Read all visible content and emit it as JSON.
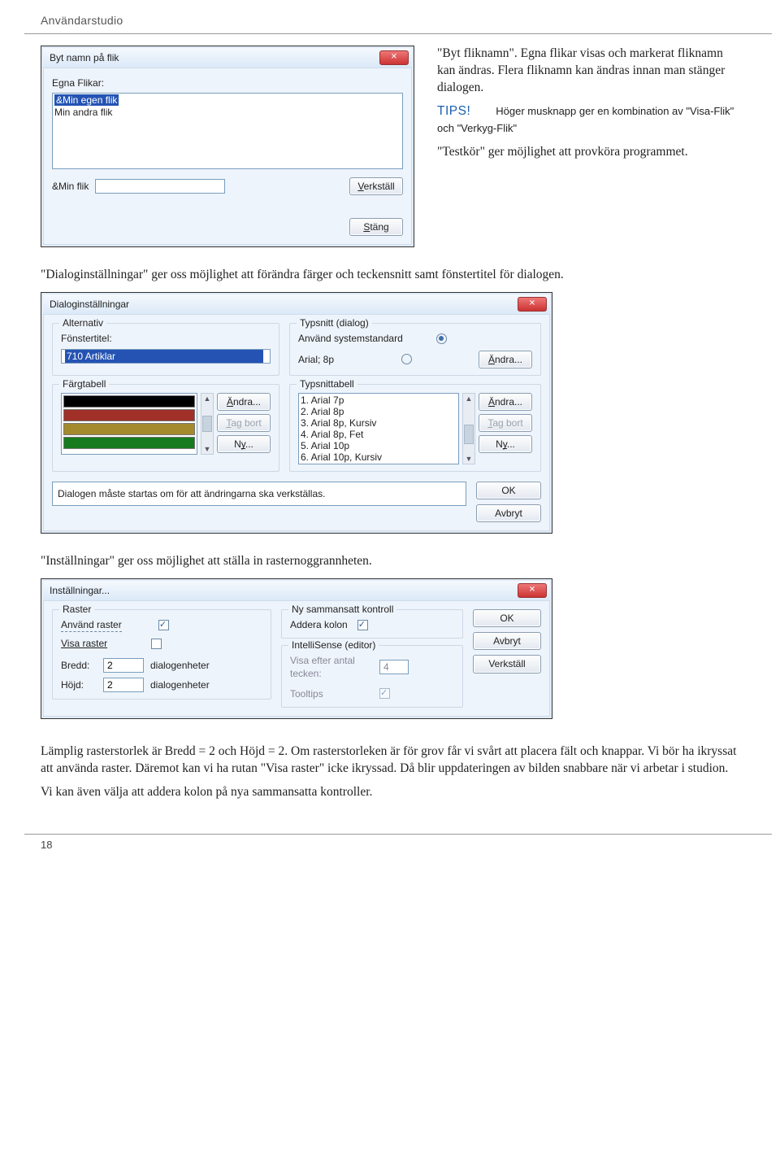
{
  "header": {
    "studio": "Användarstudio"
  },
  "dlg1": {
    "title": "Byt namn på flik",
    "label_egna": "Egna Flikar:",
    "items": [
      "&Min egen flik",
      "Min andra flik"
    ],
    "label_minflik": "&Min flik",
    "btn_verk": "Verkställ",
    "btn_stang": "Stäng"
  },
  "article": {
    "p1": "\"Byt fliknamn\". Egna flikar visas och markerat fliknamn kan ändras. Flera fliknamn kan ändras innan man stänger dialogen.",
    "tips_label": "TIPS!",
    "tips_text": "Höger musknapp ger en kombination av \"Visa-Flik\" och \"Verkyg-Flik\"",
    "p2": "\"Testkör\" ger möjlighet att provköra programmet."
  },
  "inter1": "\"Dialoginställningar\" ger oss möjlighet att förändra färger och teckensnitt samt fönstertitel för dialogen.",
  "dlg2": {
    "title": "Dialoginställningar",
    "grp_alt": "Alternativ",
    "lbl_font": "Fönstertitel:",
    "val_font": "710 Artiklar",
    "grp_typ": "Typsnitt (dialog)",
    "lbl_sys": "Använd systemstandard",
    "lbl_arial": "Arial; 8p",
    "btn_andra": "Ändra...",
    "grp_farg": "Färgtabell",
    "grp_typtab": "Typsnittabell",
    "typitems": [
      "1. Arial 7p",
      "2. Arial 8p",
      "3. Arial 8p, Kursiv",
      "4. Arial 8p, Fet",
      "5. Arial 10p",
      "6. Arial 10p, Kursiv"
    ],
    "btn_tagbort": "Tag bort",
    "btn_ny": "Ny...",
    "note": "Dialogen måste startas om för att ändringarna ska verkställas.",
    "btn_ok": "OK",
    "btn_avbryt": "Avbryt"
  },
  "inter2": "\"Inställningar\" ger oss möjlighet att ställa in rasternoggrannheten.",
  "dlg3": {
    "title": "Inställningar...",
    "grp_raster": "Raster",
    "lbl_anv": "Använd raster",
    "lbl_visa": "Visa raster",
    "lbl_bredd": "Bredd:",
    "lbl_hojd": "Höjd:",
    "val_bredd": "2",
    "val_hojd": "2",
    "unit": "dialogenheter",
    "grp_ny": "Ny sammansatt kontroll",
    "lbl_addera": "Addera kolon",
    "grp_is": "IntelliSense (editor)",
    "lbl_visa_antal": "Visa efter antal tecken:",
    "val_antal": "4",
    "lbl_tooltips": "Tooltips",
    "btn_ok": "OK",
    "btn_avbryt": "Avbryt",
    "btn_verk": "Verkställ"
  },
  "bottom": {
    "p1": "Lämplig rasterstorlek är Bredd = 2 och Höjd = 2. Om rasterstorleken är för grov får vi svårt att placera fält och knappar.  Vi bör ha ikryssat att använda raster. Däremot kan vi ha rutan \"Visa raster\" icke ikryssad. Då blir uppdateringen av bilden snabbare när vi arbetar i studion.",
    "p2": "Vi kan även välja att addera kolon på nya sammansatta kontroller."
  },
  "page_number": "18"
}
